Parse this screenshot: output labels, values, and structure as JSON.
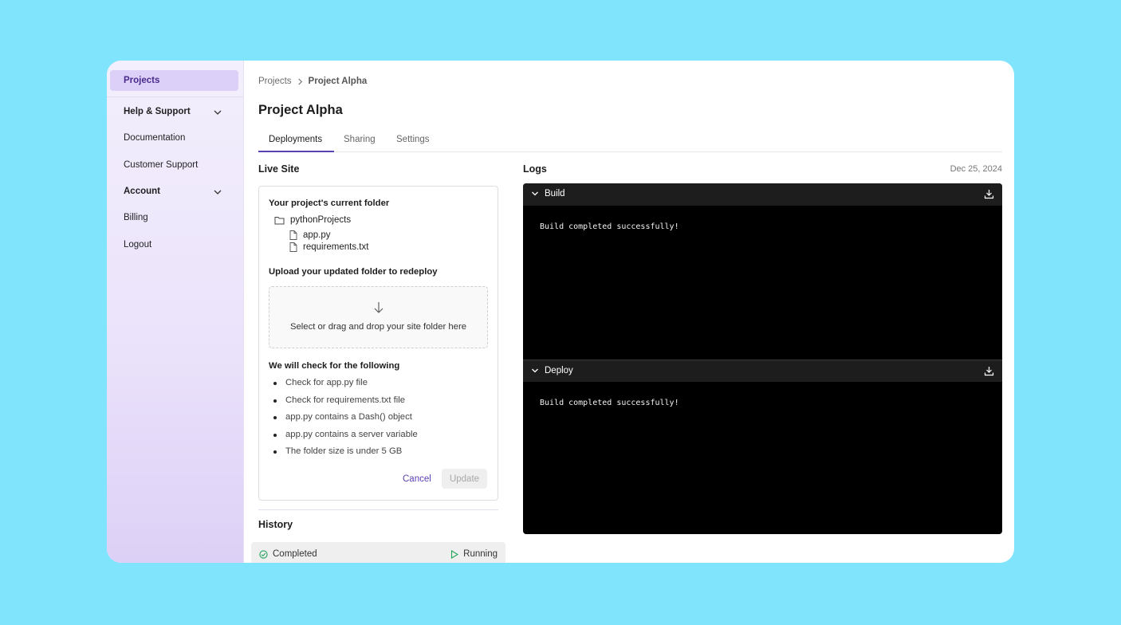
{
  "sidebar": {
    "active_label": "Projects",
    "items": [
      {
        "label": "Help & Support",
        "bold": true,
        "chevron": "chevron-down-icon"
      },
      {
        "label": "Documentation",
        "bold": false
      },
      {
        "label": "Customer Support",
        "bold": false
      },
      {
        "label": "Account",
        "bold": true,
        "chevron": "chevron-down-icon"
      },
      {
        "label": "Billing",
        "bold": false
      },
      {
        "label": "Logout",
        "bold": false
      }
    ]
  },
  "breadcrumb": {
    "root": "Projects",
    "current": "Project Alpha"
  },
  "page_title": "Project Alpha",
  "tabs": [
    {
      "label": "Deployments",
      "active": true
    },
    {
      "label": "Sharing",
      "active": false
    },
    {
      "label": "Settings",
      "active": false
    }
  ],
  "live_site": {
    "title": "Live Site",
    "folder_heading": "Your project's current folder",
    "folder_name": "pythonProjects",
    "files": [
      "app.py",
      "requirements.txt"
    ],
    "upload_heading": "Upload your updated folder to redeploy",
    "dropzone_text": "Select or drag and drop your site folder here",
    "checks_heading": "We will check for the following",
    "checks": [
      "Check for app.py file",
      "Check for requirements.txt file",
      "app.py contains a Dash() object",
      "app.py contains a server variable",
      "The folder size is under 5 GB"
    ],
    "cancel_label": "Cancel",
    "update_label": "Update"
  },
  "history": {
    "title": "History",
    "rows": [
      {
        "status": "Completed",
        "state": "Running"
      }
    ]
  },
  "logs": {
    "title": "Logs",
    "date": "Dec 25, 2024",
    "sections": [
      {
        "label": "Build",
        "line": "Build completed successfully!"
      },
      {
        "label": "Deploy",
        "line": "Build completed successfully!"
      }
    ]
  },
  "colors": {
    "background": "#80e4fc",
    "accent": "#5b3fb4",
    "sidebar_active": "#dcd0f8",
    "log_bg": "#000000",
    "log_header": "#1d1d1d",
    "success": "#22a35a"
  }
}
